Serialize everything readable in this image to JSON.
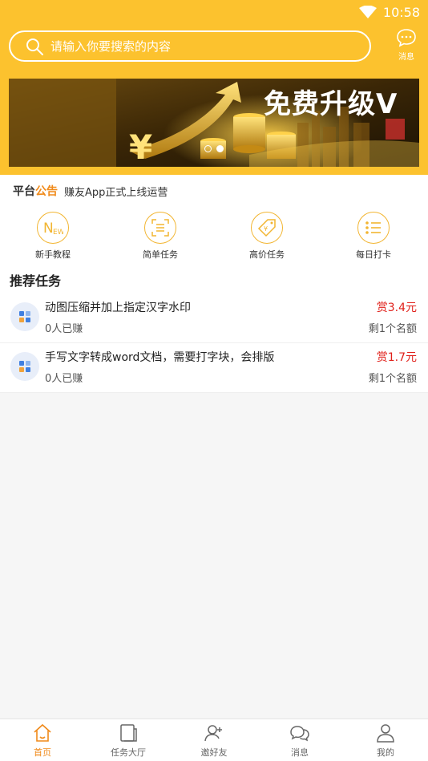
{
  "status_bar": {
    "time": "10:58"
  },
  "search": {
    "placeholder": "请输入你要搜索的内容"
  },
  "header_message": {
    "label": "消息"
  },
  "banner": {
    "title": "免费升级V",
    "dots": 2,
    "active_dot": 1
  },
  "notice": {
    "tag_prefix": "平台",
    "tag_suffix": "公告",
    "text": "赚友App正式上线运营"
  },
  "quick_menu": [
    {
      "label": "新手教程",
      "icon": "new-icon"
    },
    {
      "label": "简单任务",
      "icon": "document-scan-icon"
    },
    {
      "label": "高价任务",
      "icon": "price-tag-icon"
    },
    {
      "label": "每日打卡",
      "icon": "checklist-icon"
    }
  ],
  "recommend": {
    "title": "推荐任务",
    "tasks": [
      {
        "name": "动图压缩并加上指定汉字水印",
        "earned": "0人已赚",
        "reward": "赏3.4元",
        "remaining": "剩1个名额"
      },
      {
        "name": "手写文字转成word文档，需要打字块，会排版",
        "earned": "0人已赚",
        "reward": "赏1.7元",
        "remaining": "剩1个名额"
      }
    ]
  },
  "tabbar": [
    {
      "label": "首页",
      "icon": "home-icon",
      "active": true
    },
    {
      "label": "任务大厅",
      "icon": "task-hall-icon",
      "active": false
    },
    {
      "label": "邀好友",
      "icon": "invite-friend-icon",
      "active": false
    },
    {
      "label": "消息",
      "icon": "message-icon",
      "active": false
    },
    {
      "label": "我的",
      "icon": "profile-icon",
      "active": false
    }
  ],
  "colors": {
    "brand": "#fcc22e",
    "accent": "#f08a1a",
    "reward": "#e0201a"
  }
}
